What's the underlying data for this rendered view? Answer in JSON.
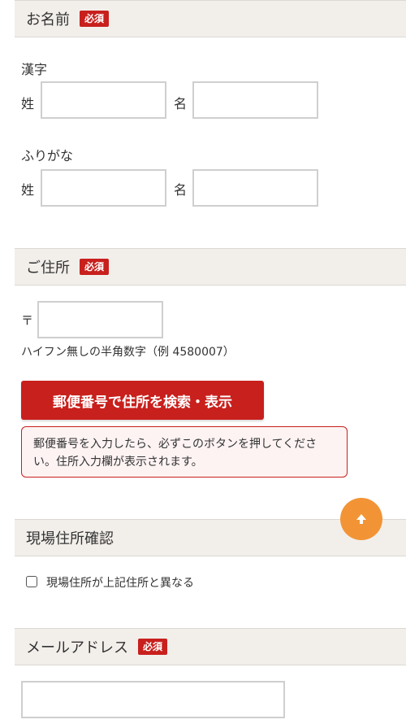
{
  "name_section": {
    "title": "お名前",
    "badge": "必須",
    "kanji_label": "漢字",
    "furigana_label": "ふりがな",
    "sei_label": "姓",
    "mei_label": "名",
    "kanji_sei_value": "",
    "kanji_mei_value": "",
    "furigana_sei_value": "",
    "furigana_mei_value": ""
  },
  "address_section": {
    "title": "ご住所",
    "badge": "必須",
    "postal_mark": "〒",
    "postal_value": "",
    "postal_hint": "ハイフン無しの半角数字（例 4580007）",
    "search_button": "郵便番号で住所を検索・表示",
    "notice": "郵便番号を入力したら、必ずこのボタンを押してください。住所入力欄が表示されます。"
  },
  "site_section": {
    "title": "現場住所確認",
    "checkbox_label": "現場住所が上記住所と異なる",
    "checked": false
  },
  "email_section": {
    "title": "メールアドレス",
    "badge": "必須",
    "email_value": ""
  },
  "colors": {
    "accent_red": "#c8201d",
    "header_bg": "#f2efeb",
    "scroll_button": "#f29436"
  },
  "icons": {
    "scroll_top": "arrow-up-icon"
  }
}
